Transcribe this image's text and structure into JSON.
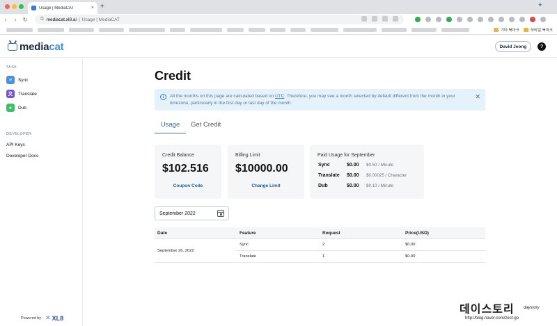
{
  "browser": {
    "tab_title": "Usage | MediaCAT",
    "tab_close": "×",
    "new_tab": "+",
    "url": "mediacat.xl8.ai",
    "url_separator": "|",
    "page_title_in_omnibox": "Usage | MediaCAT",
    "back": "‹",
    "forward": "›",
    "reload": "↻",
    "bookmark_folder_1": "기타 북마크",
    "bookmark_folder_2": "모바일 북마크"
  },
  "header": {
    "logo_part1": "media",
    "logo_part2": "cat",
    "user_button": "David Jeong",
    "help": "?"
  },
  "sidebar": {
    "task_section": "TASK",
    "items": [
      {
        "label": "Sync",
        "icon": "sync-icon",
        "glyph": "≡"
      },
      {
        "label": "Translate",
        "icon": "translate-icon",
        "glyph": "文"
      },
      {
        "label": "Dub",
        "icon": "microphone-icon",
        "glyph": "●"
      }
    ],
    "developer_section": "DEVELOPER",
    "links": [
      "API Keys",
      "Developer Docs"
    ],
    "powered_by": "Powered by",
    "brand": "XL8",
    "brand_mark": "✕"
  },
  "main": {
    "title": "Credit",
    "banner": {
      "text_before": "All the months on this page are calculated based on ",
      "utc": "UTC",
      "text_after": ". Therefore, you may see a month selected by default different from the month in your timezone, particularly in the first day or last day of the month.",
      "info": "i",
      "close": "✕"
    },
    "tabs": [
      "Usage",
      "Get Credit"
    ],
    "cards": {
      "balance": {
        "label": "Credit Balance",
        "value": "$102.516",
        "link": "Coupon Code"
      },
      "limit": {
        "label": "Billing Limit",
        "value": "$10000.00",
        "link": "Change Limit"
      },
      "usage": {
        "label": "Paid Usage for September",
        "rows": [
          {
            "name": "Sync",
            "amount": "$0.00",
            "rate": "$0.50 / Minute"
          },
          {
            "name": "Translate",
            "amount": "$0.00",
            "rate": "$0.00025 / Character"
          },
          {
            "name": "Dub",
            "amount": "$0.00",
            "rate": "$0.10 / Minute"
          }
        ]
      }
    },
    "date_picker": "September 2022",
    "table": {
      "headers": [
        "Date",
        "Feature",
        "Request",
        "Price(USD)"
      ],
      "date": "September 26, 2022",
      "rows": [
        {
          "feature": "Sync",
          "request": "2",
          "price": "$0.00"
        },
        {
          "feature": "Translate",
          "request": "1",
          "price": "$0.00"
        }
      ]
    }
  },
  "watermark": {
    "title": "데이스토리",
    "url": "http://blog.naver.com/zest-go",
    "signature": "daystory"
  }
}
